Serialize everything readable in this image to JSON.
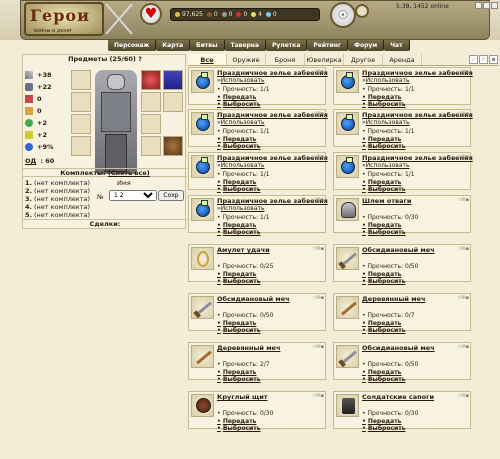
{
  "header": {
    "logo_title": "Герои",
    "logo_sub": "войны и денег",
    "resources": [
      "97,625",
      "0",
      "0",
      "0",
      "4",
      "0"
    ],
    "status": "5:38, 1452 online",
    "nav": [
      "Персонаж",
      "Карта",
      "Битвы",
      "Таверна",
      "Рулетка",
      "Рейтинг",
      "Форум",
      "Чат"
    ]
  },
  "left": {
    "title": "Предметы (25/60)",
    "help": "?",
    "stats": [
      "+38",
      "+22",
      "0",
      "0",
      "+2",
      "+2",
      "+9%"
    ],
    "od_label": "ОД",
    "od_value": "60",
    "sets_head": "Комплекты:",
    "sets_clear": "(Снять все)",
    "sets": [
      {
        "num": "1.",
        "text": "(нет комплекта)"
      },
      {
        "num": "2.",
        "text": "(нет комплекта)"
      },
      {
        "num": "3.",
        "text": "(нет комплекта)"
      },
      {
        "num": "4.",
        "text": "(нет комплекта)"
      },
      {
        "num": "5.",
        "text": "(нет комплекта)"
      }
    ],
    "name_label": "Имя",
    "no_label": "№",
    "select_value": "1 2",
    "save_button": "Сохр",
    "deals": "Сделки:"
  },
  "tabs": [
    "Все",
    "Оружие",
    "Броня",
    "Ювелирка",
    "Другое",
    "Аренда"
  ],
  "strings": {
    "durability": "Прочность:",
    "use": "Использовать",
    "transfer": "Передать",
    "discard": "Выбросить"
  },
  "items": [
    {
      "name": "Праздничное зелье забвения",
      "type": "potion",
      "dur": "1/1",
      "use": true
    },
    {
      "name": "Праздничное зелье забвения",
      "type": "potion",
      "dur": "1/1",
      "use": true
    },
    {
      "name": "Праздничное зелье забвения",
      "type": "potion",
      "dur": "1/1",
      "use": true
    },
    {
      "name": "Праздничное зелье забвения",
      "type": "potion",
      "dur": "1/1",
      "use": true
    },
    {
      "name": "Праздничное зелье забвения",
      "type": "potion",
      "dur": "1/1",
      "use": true
    },
    {
      "name": "Праздничное зелье забвения",
      "type": "potion",
      "dur": "1/1",
      "use": true
    },
    {
      "name": "Праздничное зелье забвения",
      "type": "potion",
      "dur": "1/1",
      "use": true
    },
    {
      "name": "Шлем отваги",
      "type": "helm",
      "dur": "0/30",
      "use": false
    },
    {
      "name": "Амулет удачи",
      "type": "amulet",
      "dur": "0/25",
      "use": false
    },
    {
      "name": "Обсидиановый меч",
      "type": "sword",
      "dur": "0/50",
      "use": false
    },
    {
      "name": "Обсидиановый меч",
      "type": "sword",
      "dur": "0/50",
      "use": false
    },
    {
      "name": "Деревянный меч",
      "type": "woodsword",
      "dur": "0/7",
      "use": false
    },
    {
      "name": "Деревянный меч",
      "type": "woodsword",
      "dur": "2/7",
      "use": false
    },
    {
      "name": "Обсидиановый меч",
      "type": "sword",
      "dur": "0/50",
      "use": false
    },
    {
      "name": "Круглый щит",
      "type": "shield",
      "dur": "0/30",
      "use": false
    },
    {
      "name": "Солдатские сапоги",
      "type": "boots",
      "dur": "0/30",
      "use": false
    }
  ]
}
